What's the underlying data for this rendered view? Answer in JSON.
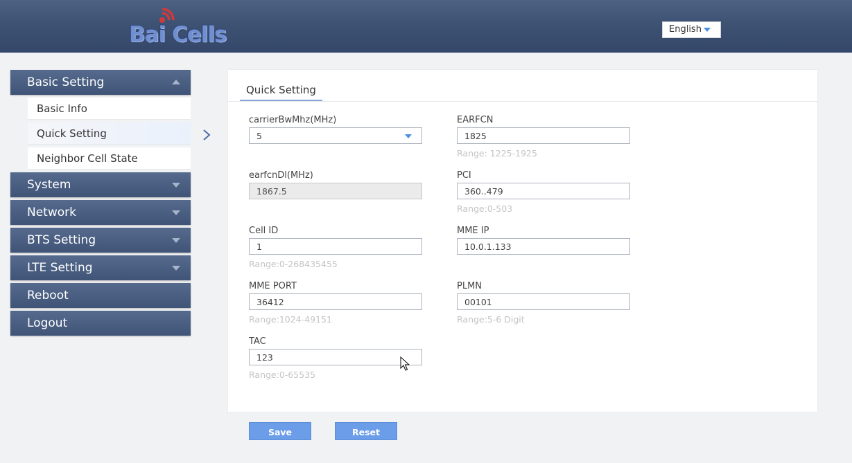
{
  "header": {
    "logo_text": "Bai Cells",
    "language": "English"
  },
  "sidebar": {
    "items": [
      {
        "label": "Basic Setting",
        "expanded": true
      },
      {
        "label": "System"
      },
      {
        "label": "Network"
      },
      {
        "label": "BTS Setting"
      },
      {
        "label": "LTE Setting"
      },
      {
        "label": "Reboot"
      },
      {
        "label": "Logout"
      }
    ],
    "sub_items": [
      {
        "label": "Basic Info"
      },
      {
        "label": "Quick Setting",
        "active": true
      },
      {
        "label": "Neighbor Cell State"
      }
    ]
  },
  "panel": {
    "tab": "Quick Setting",
    "fields": {
      "carrier_bw": {
        "label": "carrierBwMhz(MHz)",
        "value": "5"
      },
      "earfcn": {
        "label": "EARFCN",
        "value": "1825",
        "hint": "Range: 1225-1925"
      },
      "earfcn_dl": {
        "label": "earfcnDl(MHz)",
        "value": "1867.5"
      },
      "pci": {
        "label": "PCI",
        "value": "360..479",
        "hint": "Range:0-503"
      },
      "cell_id": {
        "label": "Cell ID",
        "value": "1",
        "hint": "Range:0-268435455"
      },
      "mme_ip": {
        "label": "MME IP",
        "value": "10.0.1.133"
      },
      "mme_port": {
        "label": "MME PORT",
        "value": "36412",
        "hint": "Range:1024-49151"
      },
      "plmn": {
        "label": "PLMN",
        "value": "00101",
        "hint": "Range:5-6 Digit"
      },
      "tac": {
        "label": "TAC",
        "value": "123",
        "hint": "Range:0-65535"
      }
    }
  },
  "actions": {
    "save": "Save",
    "reset": "Reset"
  },
  "colors": {
    "header": "#3e5273",
    "nav": "#4a5f82",
    "accent": "#6b9de8"
  }
}
